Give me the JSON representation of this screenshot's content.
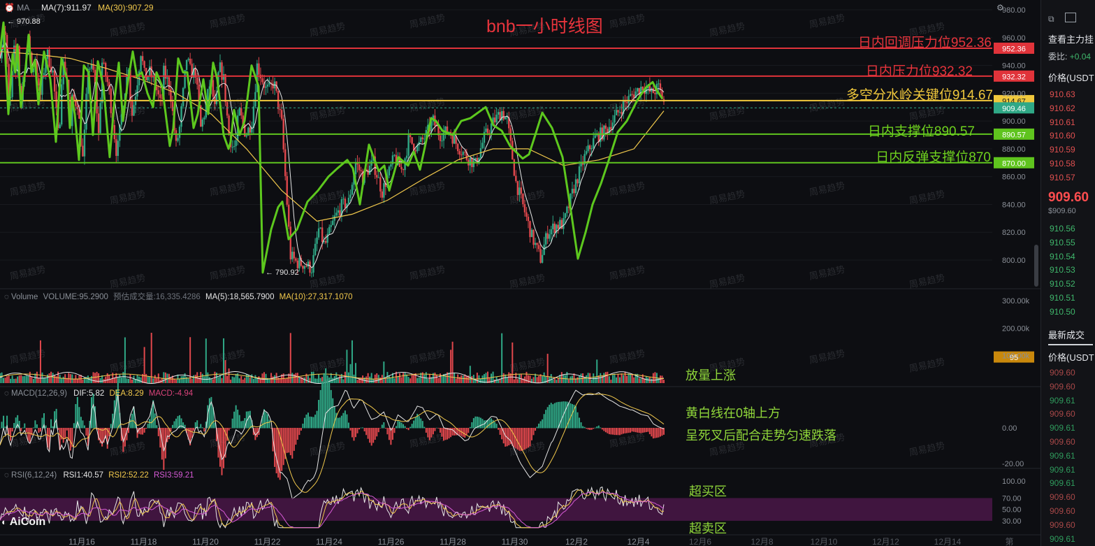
{
  "title": "bnb一小时线图",
  "indicators": {
    "ma": {
      "name": "MA",
      "ma7": "MA(7):911.97",
      "ma30": "MA(30):907.29"
    },
    "volume": {
      "name": "Volume",
      "value": "VOLUME:95.2900",
      "est": "预估成交量:16,335.4286",
      "ma5": "MA(5):18,565.7900",
      "ma10": "MA(10):27,317.1070"
    },
    "macd": {
      "name": "MACD(12,26,9)",
      "dif": "DIF:5.82",
      "dea": "DEA:8.29",
      "macd": "MACD:-4.94"
    },
    "rsi": {
      "name": "RSI(6,12,24)",
      "rsi1": "RSI1:40.57",
      "rsi2": "RSI2:52.22",
      "rsi3": "RSI3:59.21"
    }
  },
  "annotations": {
    "high_marker": "← 970.88",
    "low_marker": "← 790.92",
    "volume_note": "放量上涨",
    "macd_note1": "黄白线在0轴上方",
    "macd_note2": "呈死叉后配合走势匀速跌落",
    "overbought": "超买区",
    "oversold": "超卖区"
  },
  "logo": "AiCoin",
  "watermark": "周易趋势",
  "colors": {
    "up": "#2fa886",
    "down": "#e0474c",
    "zigzag": "#5dc81e",
    "resist": "#e0333a",
    "key": "#f0c83c",
    "support": "#5fc41e",
    "price_tag": "#2fa886",
    "rsi_band": "#4a1648"
  },
  "chart_data": [
    {
      "type": "line",
      "title": "bnb一小时线图",
      "x_ticks": [
        "11月16",
        "11月18",
        "11月20",
        "11月22",
        "11月24",
        "11月26",
        "11月28",
        "11月30",
        "12月2",
        "12月4",
        "12月6",
        "12月8",
        "12月10",
        "12月12",
        "12月14",
        "第"
      ],
      "y_ticks": [
        980,
        960,
        940,
        920,
        900,
        880,
        860,
        840,
        820,
        800
      ],
      "ylim": [
        785,
        985
      ],
      "current_price": 909.46,
      "levels": [
        {
          "label": "日内回调压力位952.36",
          "value": 952.36,
          "tag": "952.36",
          "color": "#e0333a"
        },
        {
          "label": "日内压力位932.32",
          "value": 932.32,
          "tag": "932.32",
          "color": "#e0333a"
        },
        {
          "label": "多空分水岭关键位914.67",
          "value": 914.67,
          "tag": "914.67",
          "color": "#f0c83c"
        },
        {
          "label": "日内支撑位890.57",
          "value": 890.57,
          "tag": "890.57",
          "color": "#5fc41e"
        },
        {
          "label": "日内反弹支撑位870",
          "value": 870.0,
          "tag": "870.00",
          "color": "#5fc41e"
        }
      ],
      "price_tag": "909.46",
      "zigzag": [
        [
          0,
          950
        ],
        [
          1.3,
          970.88
        ],
        [
          2.7,
          905
        ],
        [
          4,
          950
        ],
        [
          4.5,
          935
        ],
        [
          5,
          955
        ],
        [
          5.8,
          910
        ],
        [
          7.2,
          945
        ],
        [
          8.2,
          960
        ],
        [
          9,
          935
        ],
        [
          10,
          945
        ],
        [
          11.3,
          915
        ],
        [
          13.2,
          950
        ],
        [
          15,
          935
        ],
        [
          16.7,
          885
        ],
        [
          17.7,
          943
        ],
        [
          19.1,
          930
        ],
        [
          20,
          895
        ],
        [
          20.5,
          915
        ],
        [
          22,
          913
        ],
        [
          23.6,
          870
        ],
        [
          25,
          940
        ],
        [
          26.7,
          935
        ],
        [
          28,
          890
        ],
        [
          29,
          942
        ],
        [
          30.8,
          925
        ],
        [
          33.2,
          875
        ],
        [
          35,
          915
        ],
        [
          36.7,
          944
        ],
        [
          37.2,
          900
        ],
        [
          38.8,
          925
        ],
        [
          40,
          950
        ],
        [
          41.2,
          930
        ],
        [
          42.5,
          935
        ],
        [
          44.2,
          925
        ],
        [
          45.8,
          910
        ],
        [
          46.5,
          935
        ],
        [
          48.2,
          925
        ],
        [
          50,
          882
        ],
        [
          51,
          895
        ],
        [
          53,
          945
        ],
        [
          54.2,
          935
        ],
        [
          55.5,
          935
        ],
        [
          57,
          895
        ],
        [
          58,
          905
        ],
        [
          59.8,
          930
        ],
        [
          61.2,
          905
        ],
        [
          62.2,
          940
        ],
        [
          63.5,
          930
        ],
        [
          65,
          890
        ],
        [
          66.2,
          880
        ],
        [
          67,
          885
        ],
        [
          67.8,
          908
        ],
        [
          69.8,
          890
        ],
        [
          71.6,
          900
        ],
        [
          73,
          940
        ],
        [
          75.5,
          923
        ],
        [
          76.5,
          923
        ],
        [
          77.8,
          928
        ],
        [
          80,
          898
        ],
        [
          82.5,
          803
        ],
        [
          84.3,
          798
        ],
        [
          86.5,
          797
        ],
        [
          88.5,
          794
        ],
        [
          90.5,
          822
        ],
        [
          92.2,
          810
        ],
        [
          95,
          830
        ],
        [
          97,
          839
        ],
        [
          99,
          842
        ],
        [
          101,
          870
        ],
        [
          103,
          860
        ],
        [
          106,
          870
        ],
        [
          108.5,
          849
        ],
        [
          112,
          874
        ],
        [
          114.2,
          864
        ],
        [
          116,
          886
        ],
        [
          118.5,
          881
        ],
        [
          121,
          890
        ],
        [
          123,
          900
        ],
        [
          124.8,
          890
        ],
        [
          127.5,
          893
        ],
        [
          130,
          882
        ],
        [
          132.5,
          874
        ],
        [
          135,
          869
        ],
        [
          137.5,
          888
        ],
        [
          140,
          899
        ],
        [
          142.5,
          907
        ],
        [
          144,
          900
        ],
        [
          146.5,
          856
        ],
        [
          148.5,
          839
        ],
        [
          151,
          817
        ],
        [
          153.5,
          801
        ],
        [
          155.5,
          820
        ],
        [
          158,
          825
        ],
        [
          160,
          826
        ],
        [
          163,
          852
        ],
        [
          166,
          874
        ],
        [
          169,
          888
        ],
        [
          172,
          893
        ],
        [
          174.5,
          902
        ],
        [
          177,
          912
        ],
        [
          180,
          920
        ],
        [
          182.5,
          925
        ],
        [
          185,
          920
        ],
        [
          187,
          924
        ],
        [
          188.5,
          914
        ]
      ],
      "ma30_points": [
        [
          0,
          950
        ],
        [
          10,
          948
        ],
        [
          20,
          945
        ],
        [
          30,
          938
        ],
        [
          40,
          930
        ],
        [
          50,
          920
        ],
        [
          60,
          905
        ],
        [
          70,
          880
        ],
        [
          80,
          850
        ],
        [
          90,
          828
        ],
        [
          100,
          833
        ],
        [
          110,
          843
        ],
        [
          120,
          858
        ],
        [
          130,
          872
        ],
        [
          140,
          880
        ],
        [
          150,
          880
        ],
        [
          160,
          868
        ],
        [
          170,
          872
        ],
        [
          180,
          880
        ],
        [
          188.5,
          907.29
        ]
      ]
    },
    {
      "type": "bar",
      "title": "Volume",
      "y_ticks": [
        "300.00k",
        "200.00k",
        "100.00k"
      ],
      "current_tag": "95"
    },
    {
      "type": "bar",
      "title": "MACD(12,26,9)",
      "y_ticks": [
        "0.00",
        "-20.00"
      ]
    },
    {
      "type": "line",
      "title": "RSI(6,12,24)",
      "y_ticks": [
        "100.00",
        "70.00",
        "50.00",
        "30.00"
      ],
      "bands": {
        "upper": 70,
        "lower": 30
      }
    }
  ],
  "sidebar": {
    "title": "查看主力挂",
    "ratio_label": "委比:",
    "ratio_value": "+0.04",
    "price_header": "价格(USDT",
    "asks": [
      "910.63",
      "910.62",
      "910.61",
      "910.60",
      "910.59",
      "910.58",
      "910.57"
    ],
    "last_price": "909.60",
    "last_price_usd": "$909.60",
    "bids": [
      "910.56",
      "910.55",
      "910.54",
      "910.53",
      "910.52",
      "910.51",
      "910.50"
    ],
    "trades_header": "最新成交",
    "trades_price_header": "价格(USDT",
    "trades": [
      {
        "price": "909.60",
        "side": "down"
      },
      {
        "price": "909.60",
        "side": "down"
      },
      {
        "price": "909.61",
        "side": "up"
      },
      {
        "price": "909.60",
        "side": "down"
      },
      {
        "price": "909.61",
        "side": "up"
      },
      {
        "price": "909.60",
        "side": "down"
      },
      {
        "price": "909.61",
        "side": "up"
      },
      {
        "price": "909.61",
        "side": "up"
      },
      {
        "price": "909.61",
        "side": "up"
      },
      {
        "price": "909.60",
        "side": "down"
      },
      {
        "price": "909.60",
        "side": "down"
      },
      {
        "price": "909.60",
        "side": "down"
      },
      {
        "price": "909.61",
        "side": "up"
      }
    ]
  }
}
